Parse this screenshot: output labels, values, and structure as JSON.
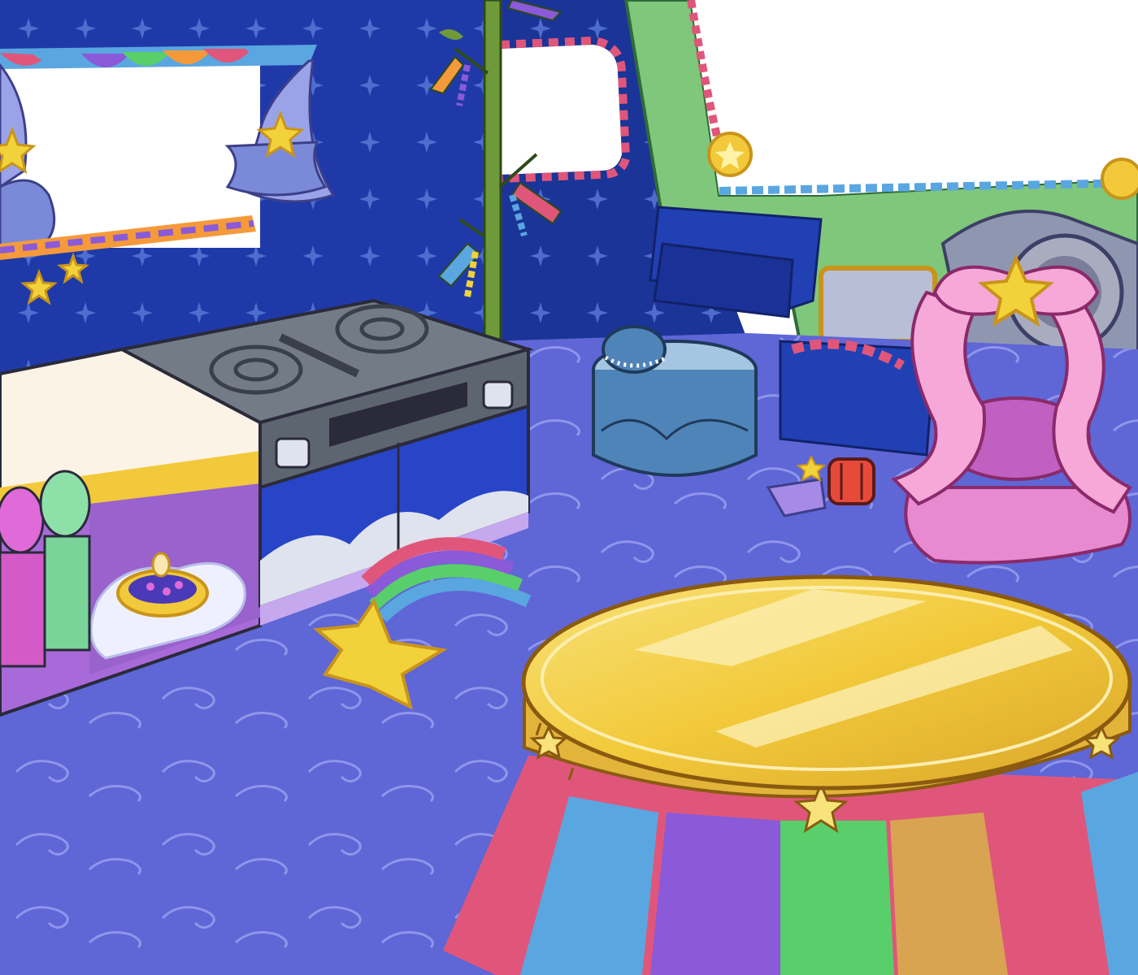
{
  "scene": {
    "description_visible_text": [],
    "colors": {
      "wall": "#1f3aa8",
      "wall_dark": "#18318f",
      "wall_star": "#5a7ad8",
      "floor": "#5f66d6",
      "floor_swirl": "#8f96ea",
      "counter_top": "#fbf3e6",
      "stove": "#737c86",
      "gold": "#f2c93a",
      "gold_dark": "#c9941a",
      "pink": "#f6a8d8",
      "green_frame": "#7fc77a",
      "rainbow": [
        "#e0567a",
        "#f59a3a",
        "#f2d23a",
        "#58cf6a",
        "#5aa6e0",
        "#8a5ad8"
      ]
    },
    "icons": [
      "star-icon",
      "shooting-star-rug-icon",
      "rainbow-table-icon",
      "bow-vanity-icon",
      "stove-icon",
      "bamboo-icon",
      "pouf-icon",
      "lantern-icon"
    ]
  }
}
